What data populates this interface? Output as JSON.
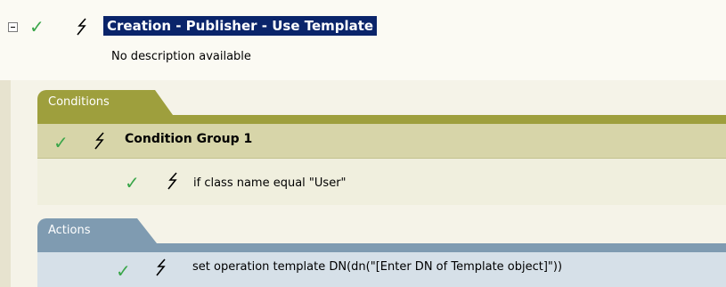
{
  "rule": {
    "title": "Creation - Publisher - Use Template",
    "description": "No description available"
  },
  "conditions": {
    "tab_label": "Conditions",
    "group_label": "Condition Group 1",
    "condition_text": "if class name equal \"User\""
  },
  "actions": {
    "tab_label": "Actions",
    "action_text": "set operation template DN(dn(\"[Enter DN of Template object]\"))"
  },
  "icons": {
    "expand": "collapse-minus-icon",
    "enabled": "green-checkmark-icon",
    "lightning": "lightning-bolt-icon"
  },
  "colors": {
    "title_bg": "#0a246a",
    "conditions_accent": "#9e9f3d",
    "actions_accent": "#7f9bb1",
    "check": "#3aa64a"
  }
}
